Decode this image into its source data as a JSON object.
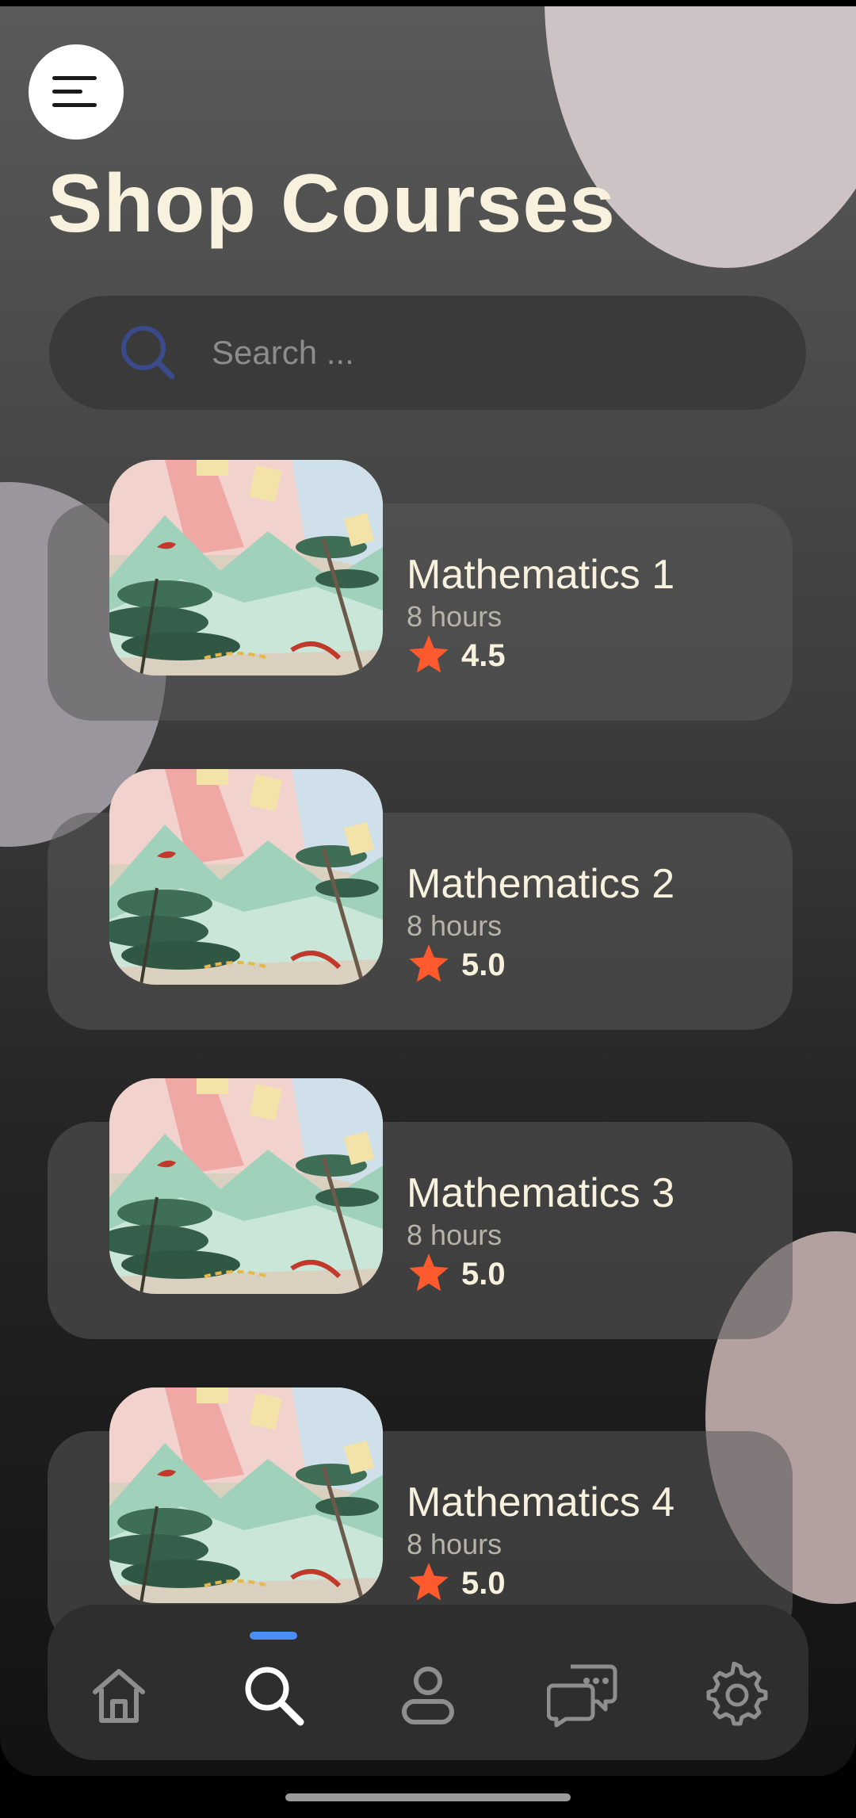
{
  "page": {
    "title": "Shop Courses"
  },
  "search": {
    "placeholder": "Search ..."
  },
  "courses": [
    {
      "title": "Mathematics 1",
      "hours": "8 hours",
      "rating": "4.5"
    },
    {
      "title": "Mathematics 2",
      "hours": "8 hours",
      "rating": "5.0"
    },
    {
      "title": "Mathematics 3",
      "hours": "8 hours",
      "rating": "5.0"
    },
    {
      "title": "Mathematics 4",
      "hours": "8 hours",
      "rating": "5.0"
    }
  ],
  "nav": {
    "items": [
      {
        "icon": "home-icon",
        "active": false
      },
      {
        "icon": "search-icon",
        "active": true
      },
      {
        "icon": "profile-icon",
        "active": false
      },
      {
        "icon": "chat-icon",
        "active": false
      },
      {
        "icon": "settings-icon",
        "active": false
      }
    ],
    "active_color": "#4a8ef5"
  },
  "colors": {
    "accent_star": "#ff5a2e",
    "title_text": "#f7f1dd",
    "search_icon": "#3a4a8a"
  },
  "icons": {
    "menu": "menu-icon",
    "search": "search-icon",
    "star": "star-icon"
  }
}
